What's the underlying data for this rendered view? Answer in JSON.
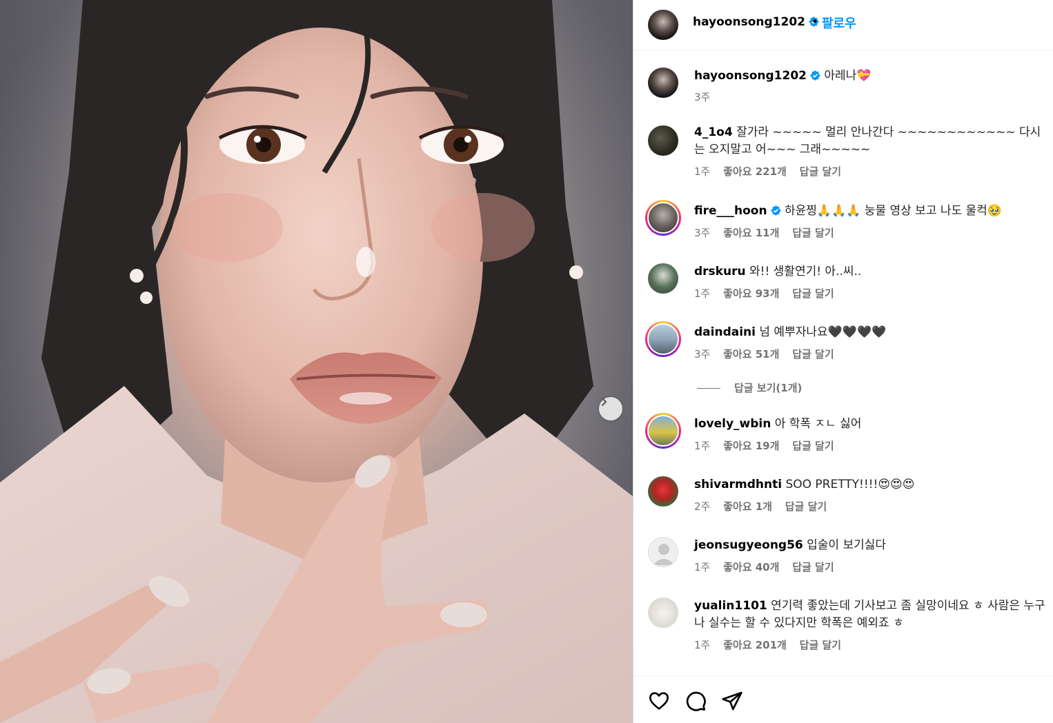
{
  "post": {
    "owner": "hayoonsong1202",
    "follow_label": "팔로우",
    "dot": "•"
  },
  "caption": {
    "username": "hayoonsong1202",
    "text": "아레나",
    "emoji": "💝",
    "time": "3주"
  },
  "comments": [
    {
      "username": "4_1o4",
      "text": "잘가라 ~~~~~ 멀리 안나간다 ~~~~~~~~~~~~ 다시는 오지말고 어~~~ 그래~~~~~",
      "time": "1주",
      "likes": "좋아요 221개",
      "reply": "답글 달기"
    },
    {
      "username": "fire___hoon",
      "text": "하윤찡🙏🙏🙏 눙물 영상 보고 나도 울컥🥹",
      "time": "3주",
      "likes": "좋아요 11개",
      "reply": "답글 달기"
    },
    {
      "username": "drskuru",
      "text": "와!! 생활연기! 아..씨..",
      "time": "1주",
      "likes": "좋아요 93개",
      "reply": "답글 달기"
    },
    {
      "username": "daindaini",
      "text": "넘 예뿌자나요🖤🖤🖤🖤",
      "time": "3주",
      "likes": "좋아요 51개",
      "reply": "답글 달기"
    },
    {
      "username": "lovely_wbin",
      "text": "아 학폭 ㅈㄴ 싫어",
      "time": "1주",
      "likes": "좋아요 19개",
      "reply": "답글 달기"
    },
    {
      "username": "shivarmdhnti",
      "text": "SOO PRETTY!!!!😍😍😍",
      "time": "2주",
      "likes": "좋아요 1개",
      "reply": "답글 달기"
    },
    {
      "username": "jeonsugyeong56",
      "text": "입술이 보기싫다",
      "time": "1주",
      "likes": "좋아요 40개",
      "reply": "답글 달기"
    },
    {
      "username": "yualin1101",
      "text": "연기력 좋았는데 기사보고 좀 실망이네요 ㅎ 사람은 누구나 실수는 할 수 있다지만 학폭은 예외죠 ㅎ",
      "time": "1주",
      "likes": "좋아요 201개",
      "reply": "답글 달기"
    }
  ],
  "view_replies": "답글 보기(1개)",
  "icons": {
    "like": "heart-icon",
    "comment": "comment-icon",
    "share": "share-icon",
    "next": "chevron-right-icon",
    "verified": "verified-badge-icon"
  },
  "colors": {
    "accent": "#0095f6",
    "secondary_text": "#737373",
    "verified": "#0095f6"
  }
}
